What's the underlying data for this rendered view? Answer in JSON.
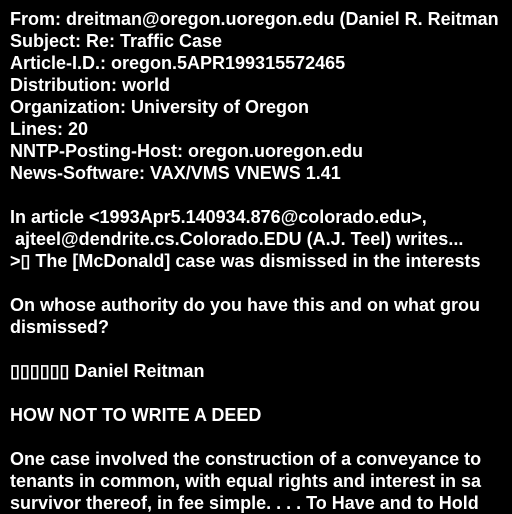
{
  "colors": {
    "background": "#000000",
    "text": "#ffffff"
  },
  "message": {
    "headers": {
      "from": "From: dreitman@oregon.uoregon.edu (Daniel R. Reitman",
      "subject": "Subject: Re: Traffic Case",
      "article_id": "Article-I.D.: oregon.5APR199315572465",
      "distribution": "Distribution: world",
      "organization": "Organization: University of Oregon",
      "lines": "Lines: 20",
      "nntp_posting_host": "NNTP-Posting-Host: oregon.uoregon.edu",
      "news_software": "News-Software: VAX/VMS VNEWS 1.41"
    },
    "body": {
      "attribution_1": "In article <1993Apr5.140934.876@colorado.edu>,",
      "attribution_2": " ajteel@dendrite.cs.Colorado.EDU (A.J. Teel) writes...",
      "quote": ">▯ The [McDonald] case was dismissed in the interests",
      "question_1": "On whose authority do you have this and on what grou",
      "question_2": "dismissed?",
      "signature": "▯▯▯▯▯▯ Daniel Reitman",
      "sig_heading": "HOW NOT TO WRITE A DEED",
      "sig_text_1": "One case involved the construction of a conveyance to",
      "sig_text_2": "tenants in common, with equal rights and interest in sa",
      "sig_text_3": "survivor thereof, in fee simple. . . . To Have and to Hold"
    }
  }
}
